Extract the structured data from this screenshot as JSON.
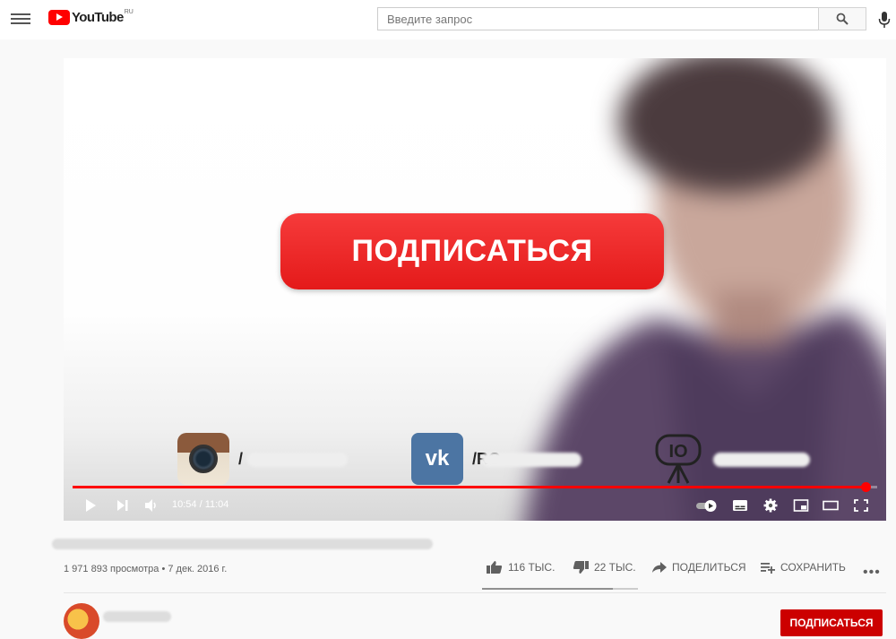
{
  "header": {
    "logo_text": "YouTube",
    "logo_region": "RU",
    "search_placeholder": "Введите запрос"
  },
  "player": {
    "subscribe_overlay": "ПОДПИСАТЬСЯ",
    "social": [
      {
        "platform": "instagram",
        "handle": "/"
      },
      {
        "platform": "vk",
        "handle": "/RO"
      },
      {
        "platform": "youtube-io",
        "handle": ""
      }
    ],
    "time": "10:54 / 11:04",
    "progress": 0.985,
    "accent_color": "#ff0000"
  },
  "video": {
    "title": "",
    "views": "1 971 893 просмотра • 7 дек. 2016 г.",
    "likes": "116 ТЫС.",
    "dislikes": "22 ТЫС.",
    "share_label": "ПОДЕЛИТЬСЯ",
    "save_label": "СОХРАНИТЬ",
    "like_ratio": 0.84
  },
  "channel": {
    "subscribe_label": "ПОДПИСАТЬСЯ"
  }
}
